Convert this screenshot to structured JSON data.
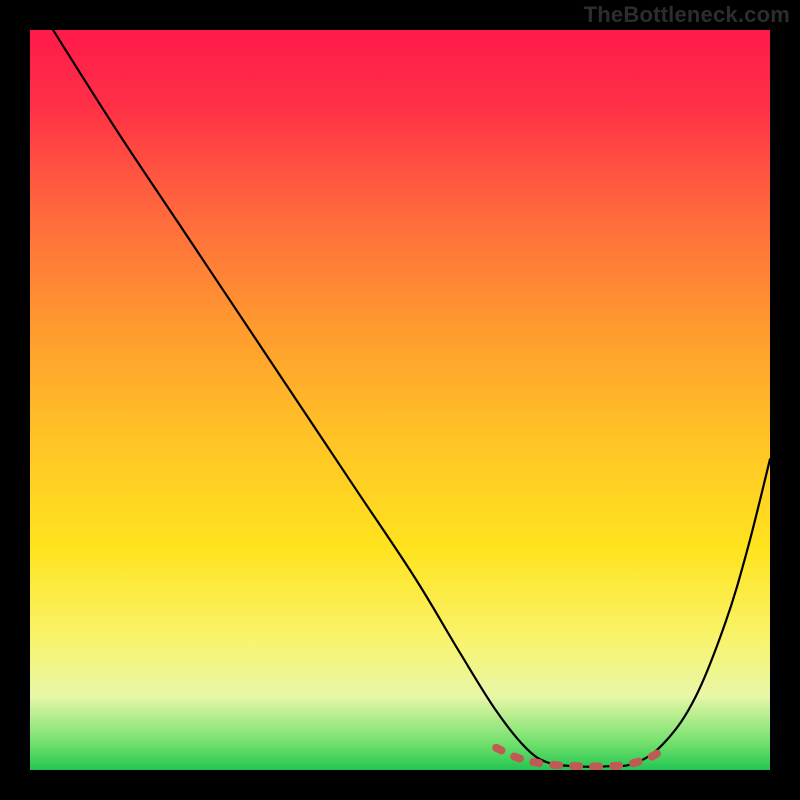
{
  "watermark": "TheBottleneck.com",
  "chart_data": {
    "type": "line",
    "title": "",
    "xlabel": "",
    "ylabel": "",
    "xlim": [
      0,
      100
    ],
    "ylim": [
      0,
      100
    ],
    "grid": false,
    "legend": false,
    "gradient_stops": [
      {
        "offset": 0.0,
        "color": "#ff1a4b"
      },
      {
        "offset": 0.1,
        "color": "#ff2f46"
      },
      {
        "offset": 0.25,
        "color": "#ff6a3d"
      },
      {
        "offset": 0.4,
        "color": "#ff9a2f"
      },
      {
        "offset": 0.55,
        "color": "#ffc326"
      },
      {
        "offset": 0.7,
        "color": "#ffe31e"
      },
      {
        "offset": 0.82,
        "color": "#f8f36a"
      },
      {
        "offset": 0.9,
        "color": "#e8f7a8"
      },
      {
        "offset": 0.965,
        "color": "#6fe06c"
      },
      {
        "offset": 1.0,
        "color": "#23c552"
      }
    ],
    "series": [
      {
        "name": "bottleneck-curve",
        "color": "#000000",
        "x": [
          0,
          5,
          12,
          20,
          28,
          36,
          44,
          52,
          58,
          63,
          67,
          70,
          74,
          78,
          82,
          86,
          90,
          94,
          97,
          100
        ],
        "values": [
          105,
          97,
          86,
          74,
          62,
          50,
          38,
          26,
          16,
          8,
          3,
          1,
          0.5,
          0.5,
          1,
          4,
          10,
          20,
          30,
          42
        ]
      }
    ],
    "minimum_band": {
      "color": "#c05a55",
      "x": [
        63,
        66,
        69,
        72,
        75,
        78,
        81,
        84,
        86
      ],
      "values": [
        3.0,
        1.6,
        0.9,
        0.6,
        0.5,
        0.5,
        0.8,
        1.8,
        3.2
      ]
    }
  }
}
